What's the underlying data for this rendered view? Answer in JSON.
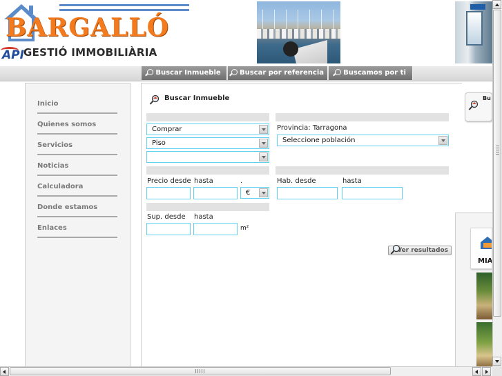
{
  "header": {
    "logo_text": "BARGALLÓ",
    "logo_subtitle": "GESTIÓ IMMOBILIÀRIA",
    "api_logo": "API"
  },
  "topnav": {
    "items": [
      {
        "label": "Buscar Inmueble",
        "icon": "magnifier-icon"
      },
      {
        "label": "Buscar por referencia",
        "icon": "magnifier-icon"
      },
      {
        "label": "Buscamos por ti",
        "icon": "magnifier-icon"
      }
    ]
  },
  "sidebar": {
    "items": [
      {
        "label": "Inicio"
      },
      {
        "label": "Quienes somos"
      },
      {
        "label": "Servicios"
      },
      {
        "label": "Noticias"
      },
      {
        "label": "Calculadora"
      },
      {
        "label": "Donde estamos"
      },
      {
        "label": "Enlaces"
      }
    ]
  },
  "search": {
    "title": "Buscar Inmueble",
    "operation": "Comprar",
    "property_type": "Piso",
    "third_select": "",
    "province_label": "Provincia: Tarragona",
    "town_select": "Seleccione población",
    "price_from_label": "Precio desde",
    "price_to_label": "hasta",
    "currency_dot": ".",
    "currency": "€",
    "rooms_from_label": "Hab. desde",
    "rooms_to_label": "hasta",
    "surface_from_label": "Sup. desde",
    "surface_to_label": "hasta",
    "surface_unit": "m²",
    "results_button": "Ver resultados"
  },
  "right": {
    "card_title": "Bu",
    "miami_label": "MIAM"
  },
  "colors": {
    "logo_orange": "#f47a1e",
    "accent_blue": "#5b8cc9",
    "input_border": "#5fd0f0",
    "nav_gray": "#7f7f7f"
  }
}
